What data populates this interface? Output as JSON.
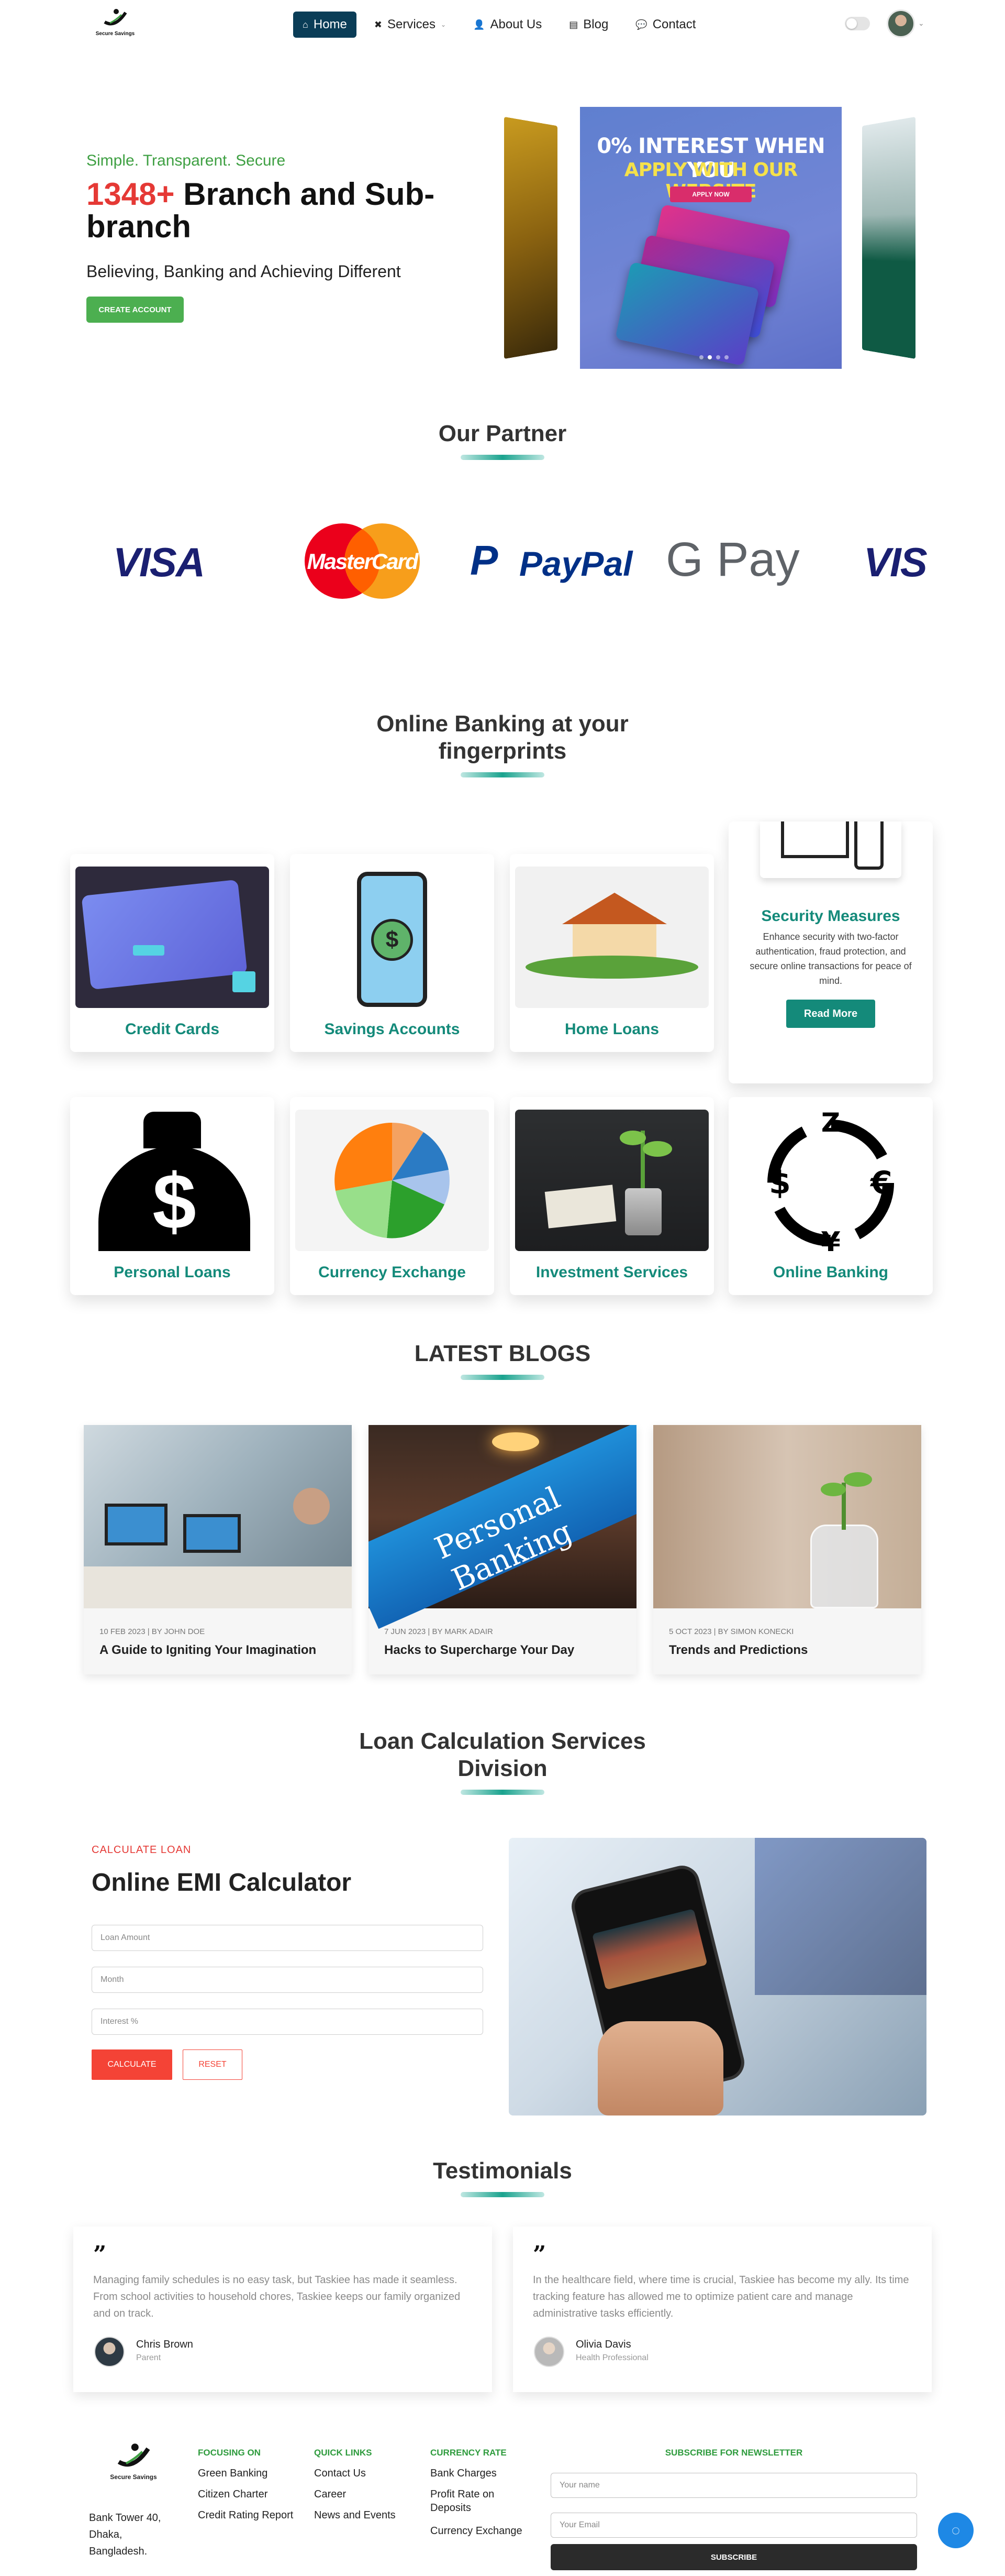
{
  "nav": {
    "logo_text": "Secure Savings",
    "items": [
      {
        "label": "Home",
        "icon": "home-icon"
      },
      {
        "label": "Services",
        "icon": "tools-icon"
      },
      {
        "label": "About Us",
        "icon": "user-icon"
      },
      {
        "label": "Blog",
        "icon": "blog-icon"
      },
      {
        "label": "Contact",
        "icon": "chat-icon"
      }
    ]
  },
  "hero": {
    "tagline": "Simple. Transparent. Secure",
    "title_number": "1348+",
    "title_rest": "Branch and Sub-branch",
    "subtitle": "Believing, Banking and Achieving Different",
    "cta": "CREATE ACCOUNT",
    "slide_line1": "0% INTEREST WHEN YOU",
    "slide_line2": "APPLY WITH OUR WEBSITE",
    "slide_button": "APPLY NOW"
  },
  "partners": {
    "title": "Our Partner",
    "items": [
      "VISA",
      "MasterCard",
      "PayPal",
      "G Pay",
      "VIS"
    ]
  },
  "services": {
    "title": "Online Banking at your fingerprints",
    "cards": [
      {
        "label": "Credit Cards"
      },
      {
        "label": "Savings Accounts"
      },
      {
        "label": "Home Loans"
      },
      {
        "label": "Personal Loans"
      },
      {
        "label": "Currency Exchange"
      },
      {
        "label": "Investment Services"
      },
      {
        "label": "Online Banking"
      }
    ],
    "security": {
      "title": "Security Measures",
      "description": "Enhance security with two-factor authentication, fraud protection, and secure online transactions for peace of mind.",
      "button": "Read More"
    }
  },
  "blogs": {
    "title": "LATEST BLOGS",
    "items": [
      {
        "meta": "10 FEB 2023 | BY JOHN DOE",
        "title": "A Guide to Igniting Your Imagination"
      },
      {
        "meta": "7 JUN 2023 | BY MARK ADAIR",
        "title": "Hacks to Supercharge Your Day",
        "sign_text": "Personal Banking"
      },
      {
        "meta": "5 OCT 2023 | BY SIMON KONECKI",
        "title": "Trends and Predictions"
      }
    ]
  },
  "loan": {
    "title": "Loan Calculation Services Division",
    "kicker": "CALCULATE LOAN",
    "heading": "Online EMI Calculator",
    "placeholders": {
      "amount": "Loan Amount",
      "month": "Month",
      "interest": "Interest %"
    },
    "calculate": "CALCULATE",
    "reset": "RESET"
  },
  "testimonials": {
    "title": "Testimonials",
    "items": [
      {
        "text": "Managing family schedules is no easy task, but Taskiee has made it seamless. From school activities to household chores, Taskiee keeps our family organized and on track.",
        "name": "Chris Brown",
        "role": "Parent"
      },
      {
        "text": "In the healthcare field, where time is crucial, Taskiee has become my ally. Its time tracking feature has allowed me to optimize patient care and manage administrative tasks efficiently.",
        "name": "Olivia Davis",
        "role": "Health Professional"
      }
    ]
  },
  "footer": {
    "logo_text": "Secure Savings",
    "address": "Bank Tower 40, Dhaka, Bangladesh.",
    "focusing_title": "FOCUSING ON",
    "focusing_links": [
      "Green Banking",
      "Citizen Charter",
      "Credit Rating Report"
    ],
    "quick_title": "QUICK LINKS",
    "quick_links": [
      "Contact Us",
      "Career",
      "News and Events"
    ],
    "rate_title": "CURRENCY RATE",
    "rate_links": [
      "Bank Charges",
      "Profit Rate on Deposits",
      "Currency Exchange"
    ],
    "newsletter_title": "SUBSCRIBE FOR NEWSLETTER",
    "name_placeholder": "Your name",
    "email_placeholder": "Your Email",
    "subscribe": "SUBSCRIBE"
  },
  "colors": {
    "nav_active": "#0a3d57",
    "green": "#4caf50",
    "teal": "#148a7a",
    "red": "#e53935"
  }
}
